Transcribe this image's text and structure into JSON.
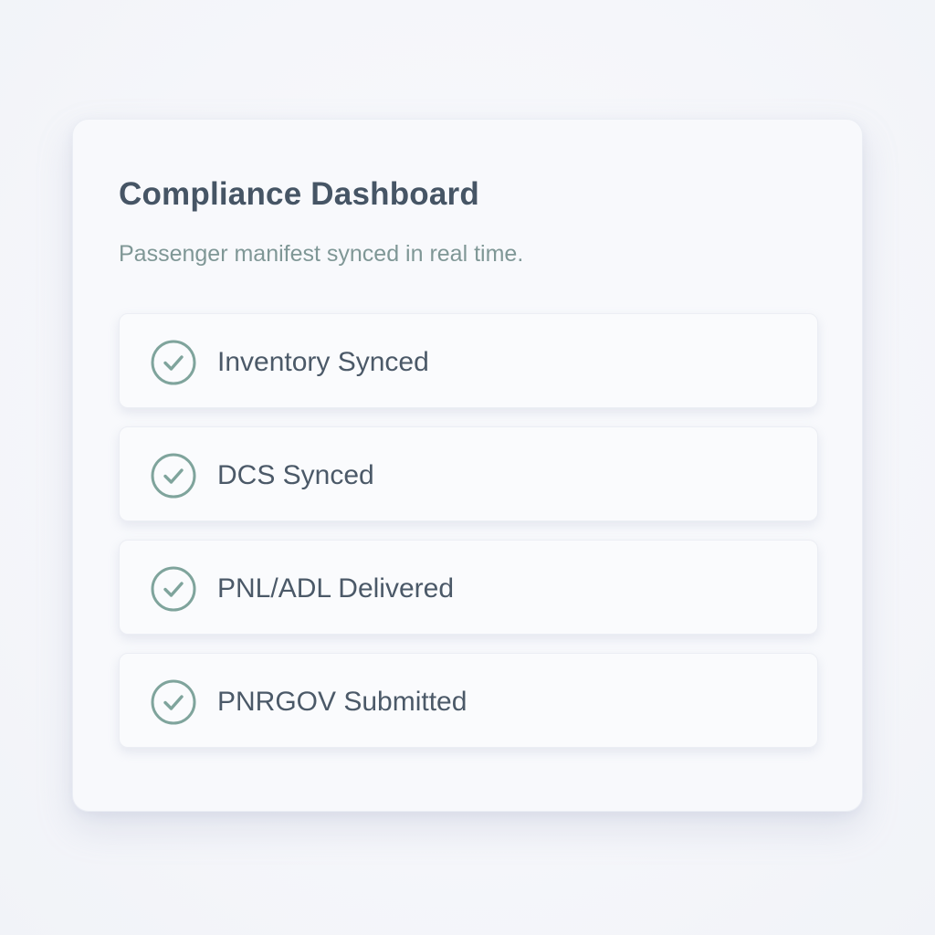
{
  "dashboard": {
    "title": "Compliance Dashboard",
    "subtitle": "Passenger manifest synced in real time."
  },
  "statuses": [
    {
      "label": "Inventory Synced",
      "icon": "check-circle-icon"
    },
    {
      "label": "DCS Synced",
      "icon": "check-circle-icon"
    },
    {
      "label": "PNL/ADL Delivered",
      "icon": "check-circle-icon"
    },
    {
      "label": "PNRGOV Submitted",
      "icon": "check-circle-icon"
    }
  ],
  "colors": {
    "check": "#7fa49c",
    "title": "#465565",
    "subtitle": "#7f9796",
    "label": "#4b5968"
  }
}
